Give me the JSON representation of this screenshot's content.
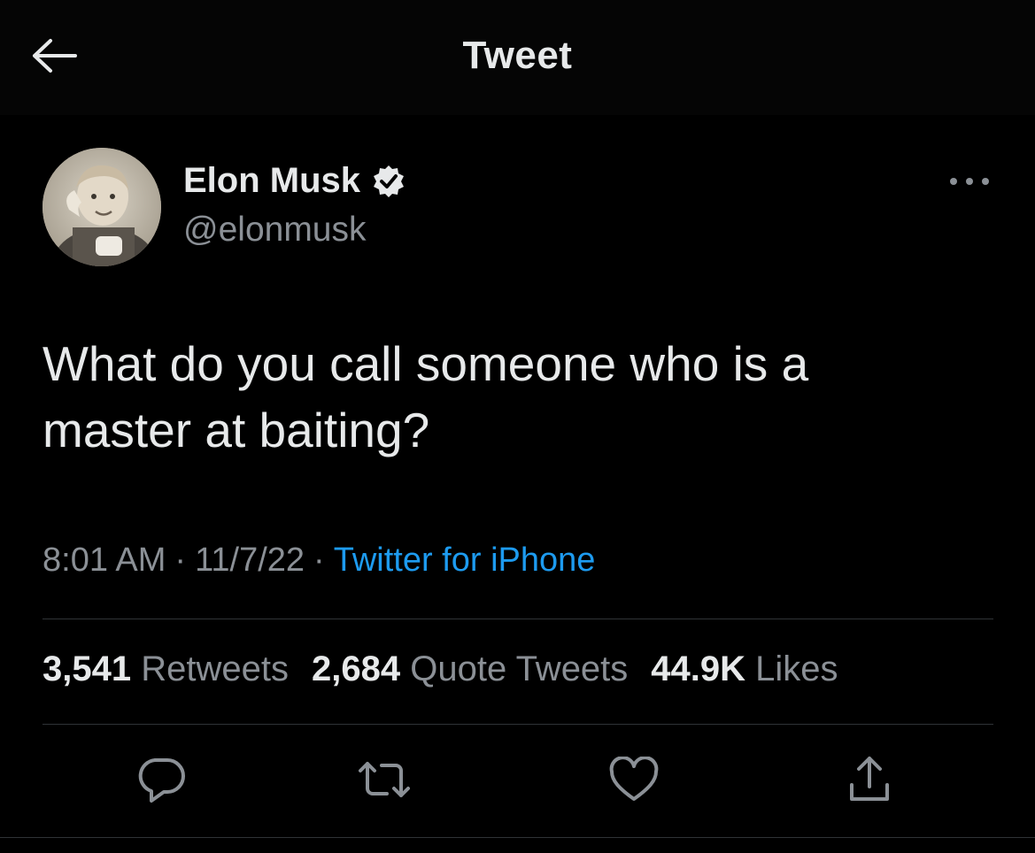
{
  "header": {
    "title": "Tweet",
    "back_icon": "arrow-left-icon"
  },
  "author": {
    "name": "Elon Musk",
    "handle": "@elonmusk",
    "verified": true,
    "verified_icon": "verified-badge-icon",
    "avatar": "avatar-photo"
  },
  "more_icon": "ellipsis-icon",
  "tweet": {
    "text_line1": "What do you call someone who is a",
    "text_line2": "master at baiting?"
  },
  "meta": {
    "time": "8:01 AM",
    "date": "11/7/22",
    "separator": "·",
    "source": "Twitter for iPhone"
  },
  "stats": {
    "retweets_count": "3,541",
    "retweets_label": "Retweets",
    "quotes_count": "2,684",
    "quotes_label": "Quote Tweets",
    "likes_count": "44.9K",
    "likes_label": "Likes"
  },
  "actions": [
    "reply-icon",
    "retweet-icon",
    "like-icon",
    "share-icon"
  ],
  "colors": {
    "background": "#000000",
    "text_primary": "#e7e9ea",
    "text_secondary": "#8b9096",
    "accent": "#1d9bf0",
    "divider": "#2f3336"
  }
}
